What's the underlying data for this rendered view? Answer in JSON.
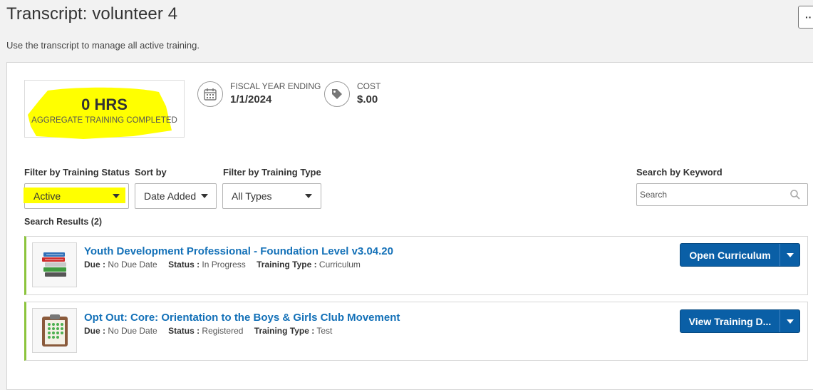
{
  "page": {
    "title": "Transcript: volunteer 4",
    "subtitle": "Use the transcript to manage all active training.",
    "more_button_label": "··"
  },
  "summary": {
    "hours_value": "0 HRS",
    "hours_label": "AGGREGATE TRAINING COMPLETED",
    "fiscal_year_label": "FISCAL YEAR ENDING",
    "fiscal_year_value": "1/1/2024",
    "cost_label": "COST",
    "cost_value": "$.00"
  },
  "filters": {
    "status_label": "Filter by Training Status",
    "status_value": "Active",
    "sort_label": "Sort by",
    "sort_value": "Date Added",
    "type_label": "Filter by Training Type",
    "type_value": "All Types",
    "keyword_label": "Search by Keyword",
    "keyword_placeholder": "Search"
  },
  "results": {
    "count_label": "Search Results (2)",
    "items": [
      {
        "title": "Youth Development Professional - Foundation Level v3.04.20",
        "due_label": "Due :",
        "due_value": "No Due Date",
        "status_label": "Status :",
        "status_value": "In Progress",
        "type_label": "Training Type :",
        "type_value": "Curriculum",
        "action_label": "Open Curriculum",
        "icon": "books-icon"
      },
      {
        "title": "Opt Out: Core: Orientation to the Boys & Girls Club Movement",
        "due_label": "Due :",
        "due_value": "No Due Date",
        "status_label": "Status :",
        "status_value": "Registered",
        "type_label": "Training Type :",
        "type_value": "Test",
        "action_label": "View Training D...",
        "icon": "clipboard-icon"
      }
    ]
  },
  "colors": {
    "highlight": "#ffff00",
    "link": "#1471b8",
    "button": "#0a5fa6",
    "row_accent": "#8cc43c"
  }
}
